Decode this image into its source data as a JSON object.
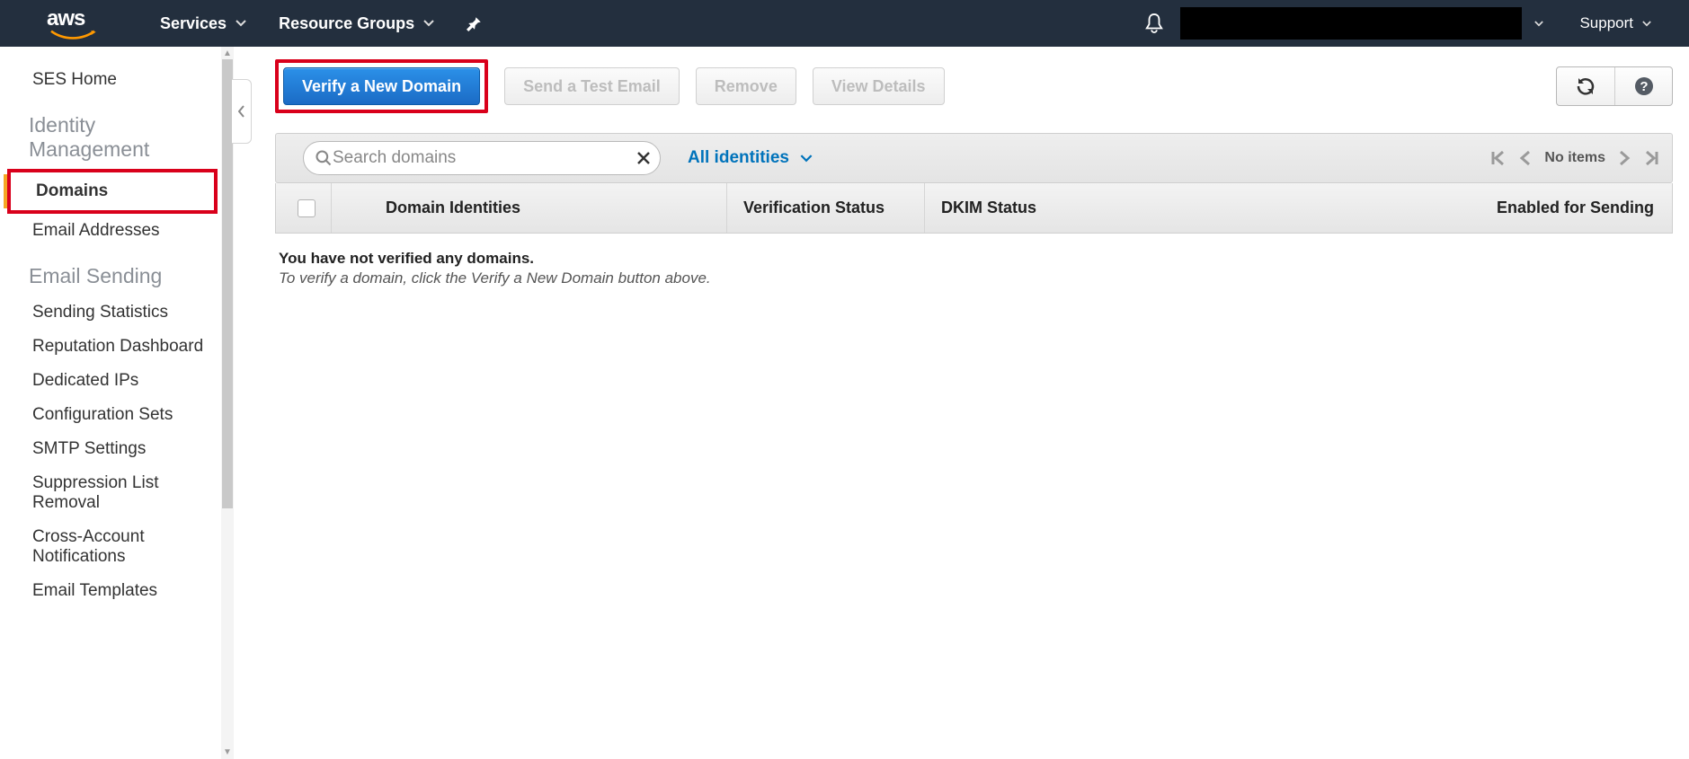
{
  "header": {
    "services_label": "Services",
    "resource_groups_label": "Resource Groups",
    "support_label": "Support"
  },
  "sidebar": {
    "home_label": "SES Home",
    "section_identity": "Identity Management",
    "identity_items": {
      "domains": "Domains",
      "email_addresses": "Email Addresses"
    },
    "section_sending": "Email Sending",
    "sending_items": {
      "sending_statistics": "Sending Statistics",
      "reputation_dashboard": "Reputation Dashboard",
      "dedicated_ips": "Dedicated IPs",
      "configuration_sets": "Configuration Sets",
      "smtp_settings": "SMTP Settings",
      "suppression_list_removal": "Suppression List Removal",
      "cross_account_notifications": "Cross-Account Notifications",
      "email_templates": "Email Templates"
    }
  },
  "toolbar": {
    "verify_label": "Verify a New Domain",
    "send_test_label": "Send a Test Email",
    "remove_label": "Remove",
    "view_details_label": "View Details"
  },
  "filter": {
    "search_placeholder": "Search domains",
    "dropdown_label": "All identities",
    "pager_label": "No items"
  },
  "table": {
    "col_domain": "Domain Identities",
    "col_verification": "Verification Status",
    "col_dkim": "DKIM Status",
    "col_enabled": "Enabled for Sending"
  },
  "empty_state": {
    "title": "You have not verified any domains.",
    "hint": "To verify a domain, click the Verify a New Domain button above."
  }
}
